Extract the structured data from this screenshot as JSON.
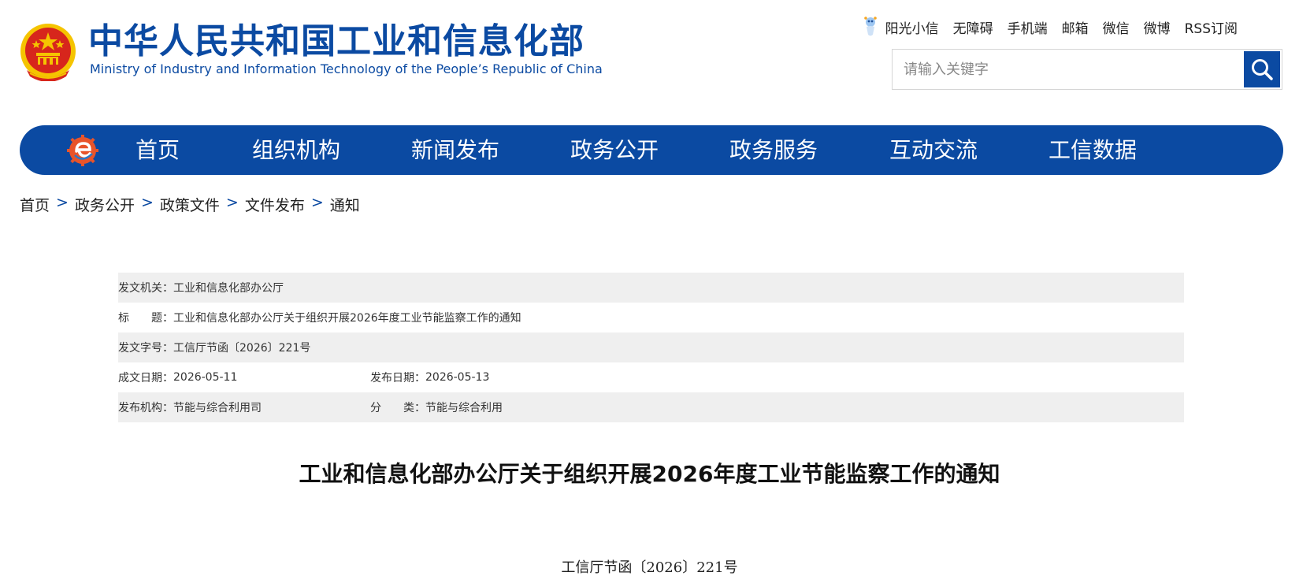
{
  "header": {
    "title_cn": "中华人民共和国工业和信息化部",
    "title_en": "Ministry of Industry and Information Technology of the People’s Republic of China",
    "top_links": [
      "阳光小信",
      "无障碍",
      "手机端",
      "邮箱",
      "微信",
      "微博",
      "RSS订阅"
    ],
    "search": {
      "placeholder": "请输入关键字",
      "icon": "search-icon"
    }
  },
  "nav": {
    "items": [
      "首页",
      "组织机构",
      "新闻发布",
      "政务公开",
      "政务服务",
      "互动交流",
      "工信数据"
    ]
  },
  "breadcrumb": {
    "items": [
      "首页",
      "政务公开",
      "政策文件",
      "文件发布",
      "通知"
    ],
    "separator": ">"
  },
  "meta": {
    "issuer_label": "发文机关：",
    "issuer": "工业和信息化部办公厅",
    "title_label": "标　　题：",
    "title": "工业和信息化部办公厅关于组织开展2026年度工业节能监察工作的通知",
    "doc_no_label": "发文字号：",
    "doc_no": "工信厅节函〔2026〕221号",
    "written_label": "成文日期：",
    "written": "2026-05-11",
    "published_label": "发布日期：",
    "published": "2026-05-13",
    "org_label": "发布机构：",
    "org": "节能与综合利用司",
    "category_label": "分　　类：",
    "category": "节能与综合利用"
  },
  "document": {
    "title": "工业和信息化部办公厅关于组织开展2026年度工业节能监察工作的通知",
    "number": "工信厅节函〔2026〕221号"
  },
  "colors": {
    "brand_blue": "#0b4aa2",
    "row_shade": "#efefef",
    "emblem_red": "#d7261c",
    "emblem_gold": "#f5c400"
  }
}
